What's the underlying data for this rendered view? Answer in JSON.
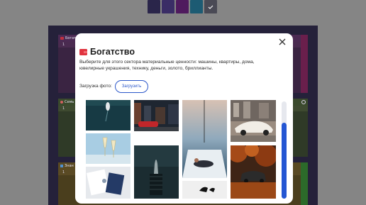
{
  "swatches": [
    {
      "name": "navy",
      "color": "#2a254a"
    },
    {
      "name": "indigo",
      "color": "#3a2d66"
    },
    {
      "name": "purple",
      "color": "#4f1a5e"
    },
    {
      "name": "teal",
      "color": "#1d5b73"
    },
    {
      "name": "selected",
      "color": "#4a4a55"
    }
  ],
  "board": {
    "rows": [
      {
        "label": "Богат",
        "num": "1",
        "color": "#4b2a53",
        "icon": "wallet-icon"
      },
      {
        "label": "Семь",
        "num": "1",
        "color": "#3a4a2c",
        "icon": "heart-icon"
      },
      {
        "label": "Знан",
        "num": "1",
        "color": "#5a4a22",
        "icon": "book-icon"
      }
    ]
  },
  "modal": {
    "title": "Богатство",
    "title_icon": "wallet-icon",
    "accent": "#e0343f",
    "description": "Выберите для этого сектора материальные ценности: машины, квартиры, дома, ювелирные украшения, технику, деньги, золото, бриллианты.",
    "upload_label": "Загрузка фото:",
    "upload_button": "Загрузить",
    "close_icon": "close-icon"
  },
  "photos": [
    {
      "name": "photo-boat-aerial",
      "desc": "yacht aerial"
    },
    {
      "name": "photo-champagne",
      "desc": "champagne toast"
    },
    {
      "name": "photo-cufflinks",
      "desc": "businessman cufflinks"
    },
    {
      "name": "photo-red-car-street",
      "desc": "red car at night"
    },
    {
      "name": "photo-rolls-royce-emblem",
      "desc": "rolls royce"
    },
    {
      "name": "photo-yacht-deck",
      "desc": "woman on yacht deck"
    },
    {
      "name": "photo-shoes",
      "desc": "shoes"
    },
    {
      "name": "photo-lamborghini-white",
      "desc": "white sports car"
    },
    {
      "name": "photo-car-autumn",
      "desc": "car in autumn forest"
    }
  ]
}
